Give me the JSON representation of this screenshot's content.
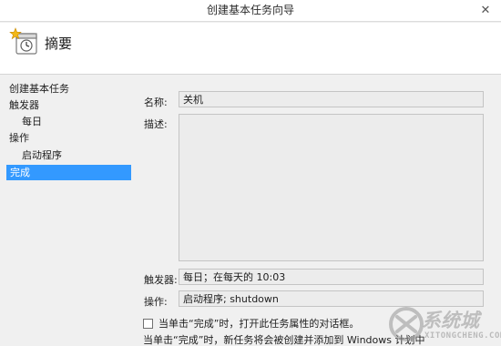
{
  "window": {
    "title": "创建基本任务向导",
    "close_glyph": "✕"
  },
  "header": {
    "title": "摘要",
    "icon": "task-wizard-icon"
  },
  "sidebar": {
    "items": [
      {
        "label": "创建基本任务",
        "level": "top",
        "selected": false
      },
      {
        "label": "触发器",
        "level": "top",
        "selected": false
      },
      {
        "label": "每日",
        "level": "sub",
        "selected": false
      },
      {
        "label": "操作",
        "level": "top",
        "selected": false
      },
      {
        "label": "启动程序",
        "level": "sub",
        "selected": false
      },
      {
        "label": "完成",
        "level": "top",
        "selected": true
      }
    ]
  },
  "summary": {
    "name_label": "名称:",
    "name_value": "关机",
    "description_label": "描述:",
    "description_value": "",
    "trigger_label": "触发器:",
    "trigger_value": "每日；在每天的 10:03",
    "action_label": "操作:",
    "action_value": "启动程序; shutdown"
  },
  "options": {
    "open_properties_label": "当单击“完成”时，打开此任务属性的对话框。",
    "open_properties_checked": false
  },
  "footer": {
    "info_text": "当单击“完成”时，新任务将会被创建并添加到 Windows 计划中"
  },
  "watermark": {
    "text": "系统城",
    "sub": "XITONGCHENG.COM"
  },
  "colors": {
    "selection": "#3399ff",
    "field_bg": "#ececec",
    "window_bg": "#f0f0f0"
  }
}
